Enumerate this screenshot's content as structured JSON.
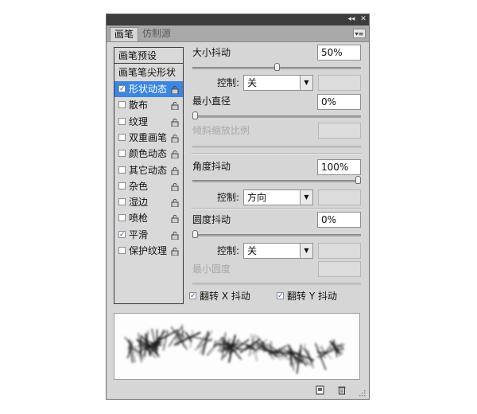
{
  "titlebar": {
    "collapse_icon": "double-chevron-left-icon",
    "close_icon": "close-icon"
  },
  "tabs": [
    {
      "label": "画笔",
      "active": true
    },
    {
      "label": "仿制源",
      "active": false
    }
  ],
  "left_panel": {
    "preset_button": "画笔预设",
    "tip_shape": "画笔笔尖形状",
    "options": [
      {
        "label": "形状动态",
        "checked": true,
        "selected": true
      },
      {
        "label": "散布",
        "checked": false,
        "selected": false
      },
      {
        "label": "纹理",
        "checked": false,
        "selected": false
      },
      {
        "label": "双重画笔",
        "checked": false,
        "selected": false
      },
      {
        "label": "颜色动态",
        "checked": false,
        "selected": false
      },
      {
        "label": "其它动态",
        "checked": false,
        "selected": false
      },
      {
        "label": "杂色",
        "checked": false,
        "selected": false
      },
      {
        "label": "湿边",
        "checked": false,
        "selected": false
      },
      {
        "label": "喷枪",
        "checked": false,
        "selected": false
      },
      {
        "label": "平滑",
        "checked": true,
        "selected": false
      },
      {
        "label": "保护纹理",
        "checked": false,
        "selected": false
      }
    ]
  },
  "settings": {
    "size_jitter": {
      "label": "大小抖动",
      "value": "50%",
      "slider_fraction": 0.5
    },
    "size_control": {
      "label": "控制:",
      "value": "关"
    },
    "min_diameter": {
      "label": "最小直径",
      "value": "0%",
      "slider_fraction": 0.0
    },
    "tilt_scale": {
      "label": "倾斜缩放比例"
    },
    "angle_jitter": {
      "label": "角度抖动",
      "value": "100%",
      "slider_fraction": 1.0
    },
    "angle_control": {
      "label": "控制:",
      "value": "方向"
    },
    "roundness_jitter": {
      "label": "圆度抖动",
      "value": "0%",
      "slider_fraction": 0.0
    },
    "roundness_control": {
      "label": "控制:",
      "value": "关"
    },
    "min_roundness": {
      "label": "最小圆度"
    },
    "flip_x": {
      "label": "翻转 X 抖动",
      "checked": true
    },
    "flip_y": {
      "label": "翻转 Y 抖动",
      "checked": true
    }
  },
  "footer": {
    "new_icon": "new-brush-icon",
    "delete_icon": "trash-icon",
    "resize_icon": "resize-grip-icon"
  }
}
